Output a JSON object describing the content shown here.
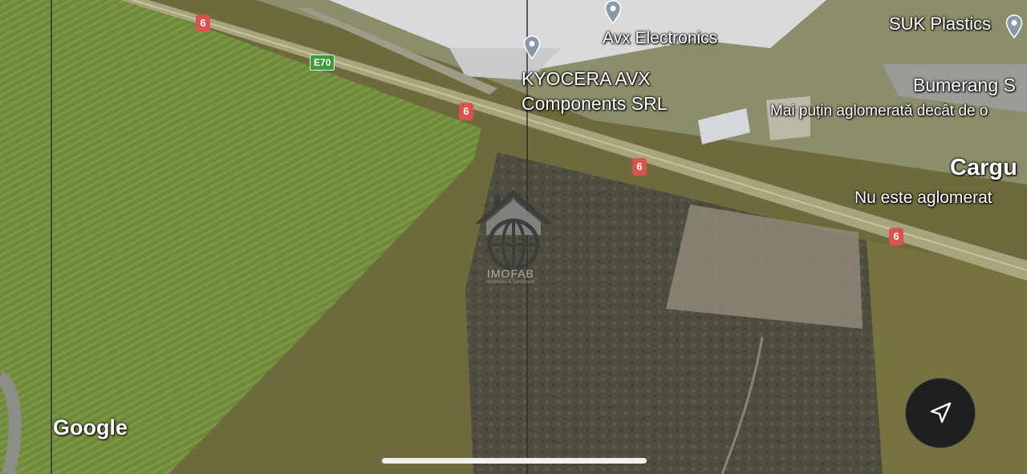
{
  "map": {
    "road_number": "6",
    "euro_route": "E70",
    "attribution": "Google",
    "places": [
      {
        "name": "Avx Electronics"
      },
      {
        "name_line1": "KYOCERA AVX",
        "name_line2": "Components SRL"
      },
      {
        "name": "SUK Plastics"
      },
      {
        "name": "Bumerang S",
        "status": "Mai puțin aglomerată decât de o"
      },
      {
        "name": "Cargu",
        "status": "Nu este aglomerat"
      }
    ]
  },
  "watermark": {
    "brand": "IMOFAB",
    "tagline": "imobiliare & constructii"
  },
  "colors": {
    "road_badge": "#d9534f",
    "euro_badge": "#3f9a3a",
    "pin": "#8a99a8"
  },
  "controls": {
    "compass_icon": "navigation-arrow-icon"
  }
}
